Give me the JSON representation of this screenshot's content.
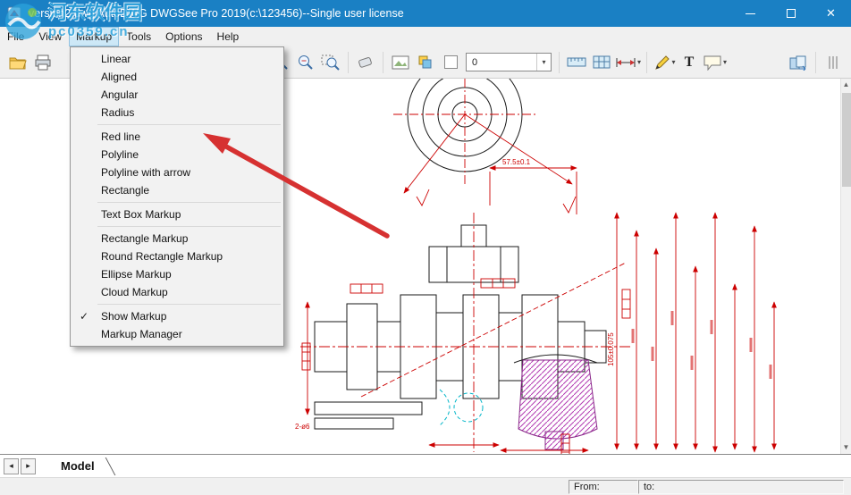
{
  "window": {
    "title": "version2.dwg AutoDWG DWGSee Pro 2019(c:\\123456)--Single user license",
    "close": "✕"
  },
  "menubar": {
    "items": [
      "File",
      "View",
      "Markup",
      "Tools",
      "Options",
      "Help"
    ]
  },
  "markup_menu": {
    "group1": [
      "Linear",
      "Aligned",
      "Angular",
      "Radius"
    ],
    "group2": [
      "Red line",
      "Polyline",
      "Polyline with arrow",
      "Rectangle"
    ],
    "group3": [
      "Text Box Markup"
    ],
    "group4": [
      "Rectangle Markup",
      "Round Rectangle Markup",
      "Ellipse Markup",
      "Cloud Markup"
    ],
    "group5": [
      "Show Markup",
      "Markup Manager"
    ],
    "checkmark": "✓"
  },
  "toolbar": {
    "layer_value": "0",
    "text_tool": "T",
    "caret": "▾"
  },
  "drawing": {
    "dim_top": "57.5±0.1",
    "dim_right": "105±0.075",
    "dim_bottom_left": "2-ø6"
  },
  "tabbar": {
    "prev": "◂",
    "next": "▸",
    "model_tab": "Model"
  },
  "statusbar": {
    "from_label": "From:",
    "to_label": "to:"
  },
  "watermark": {
    "line1": "河东软件园",
    "line2": "pc0359.cn"
  },
  "scrollbar": {
    "up": "▲",
    "down": "▼"
  }
}
